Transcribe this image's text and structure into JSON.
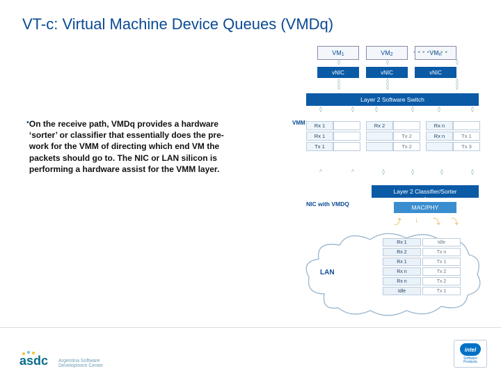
{
  "title": "VT-c: Virtual Machine Device Queues (VMDq)",
  "bullet": {
    "marker": "•",
    "text": "On the receive path, VMDq provides a hardware ‘sorter’ or classifier that essentially does the pre-work for the VMM of directing which end VM the packets should go to. The NIC or LAN silicon is performing a hardware assist for the VMM layer."
  },
  "diagram": {
    "vms": [
      "VM",
      "VM",
      "VM"
    ],
    "vm_sub": [
      "1",
      "2",
      "n"
    ],
    "vnic": "vNIC",
    "dots": "••••••••",
    "l2_switch": "Layer 2 Software Switch",
    "vmm_label": "VMM",
    "queues": {
      "col1": [
        [
          "Rx 1",
          ""
        ],
        [
          "Rx 1",
          ""
        ],
        [
          "Tx 1",
          ""
        ]
      ],
      "col2": [
        [
          "Rx 2",
          ""
        ],
        [
          "",
          "Tx 2"
        ],
        [
          "",
          "Tx 2"
        ]
      ],
      "col3": [
        [
          "Rx n",
          ""
        ],
        [
          "Rx n",
          "Tx 1"
        ],
        [
          "",
          "Tx 3"
        ]
      ]
    },
    "l2_classifier": "Layer 2 Classifier/Sorter",
    "macphy": "MAC/PHY",
    "nic_label": "NIC with VMDQ",
    "lan_label": "LAN",
    "lan_cells": [
      [
        "Rx 1",
        "Idle"
      ],
      [
        "Rx 2",
        "Tx n"
      ],
      [
        "Rx 1",
        "Tx 1"
      ],
      [
        "Rx n",
        "Tx 2"
      ],
      [
        "Rx n",
        "Tx 2"
      ],
      [
        "Idle",
        "Tx 1"
      ]
    ]
  },
  "footer": {
    "asdc_line1": "Argentina Software",
    "asdc_line2": "Development Center",
    "intel": "intel",
    "intel_sub1": "Software",
    "intel_sub2": "Products"
  }
}
